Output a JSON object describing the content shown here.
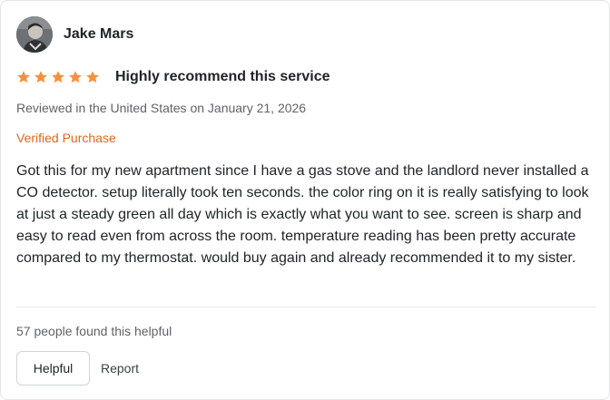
{
  "review": {
    "author": {
      "name": "Jake Mars",
      "avatar_icon": "user-photo-avatar"
    },
    "rating": {
      "value": 5,
      "max": 5,
      "star_color": "#f7913d"
    },
    "title": "Highly recommend this service",
    "meta": "Reviewed in the United States on January 21, 2026",
    "verified_label": "Verified Purchase",
    "verified_color": "#e0651c",
    "body": "Got this for my new apartment since I have a gas stove and the landlord never installed a CO detector. setup literally took ten seconds. the color ring on it is really satisfying to look at just a steady green all day which is exactly what you want to see. screen is sharp and easy to read even from across the room. temperature reading has been pretty accurate compared to my thermostat. would buy again and already recommended it to my sister.",
    "helpful_count_text": "57 people found this helpful"
  },
  "actions": {
    "helpful_label": "Helpful",
    "report_label": "Report"
  }
}
